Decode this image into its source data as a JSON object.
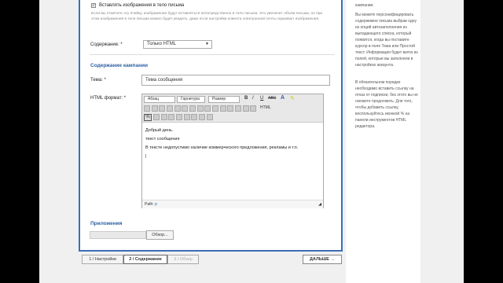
{
  "checkbox_label": "Вставлять изображения в тело письма",
  "checkbox_note": "Если вы отметите эту ячейку, изображения будут вставляться непосредственно в тело письма. Это увеличит объем письма, но при этом изображения в теле письма можно будет увидеть, даже если настройки клиента электронной почты скрывают изображения.",
  "content": {
    "label": "Содержание: *",
    "value": "Только HTML"
  },
  "campaign_heading": "Содержание кампании",
  "subject": {
    "label": "Тема: *",
    "value": "Тема сообщения"
  },
  "html_format": {
    "label": "HTML формат: *",
    "toolbar": {
      "paragraph": "Абзац",
      "font": "Гарнитура",
      "size": "Размер",
      "bold": "B",
      "italic": "I",
      "underline": "U",
      "strike": "ABC",
      "source": "HTML"
    },
    "body_lines": [
      "Добрый день.",
      "текст сообщения",
      "В тексте недопустимо наличие коммерческого предложения, рекламы и т.п."
    ],
    "path_label": "Path:",
    "path_value": "p"
  },
  "attachments": {
    "heading": "Приложения",
    "browse_label": "Обзор..."
  },
  "steps": {
    "step1": "1 / Настройки",
    "step2": "2 / Содержание",
    "step3": "3 / Обзор"
  },
  "next_button": "ДАЛЬШЕ →",
  "sidebar": {
    "top": "кампании.",
    "p1": "Вы можете персонифицировать содержимое письма выбрав одну из опций автозаполнения из выпадающего списка, который появится, когда вы поставите курсор в поле Тема или Простой текст. Информация будет взята из полей, которые вы заполняли в настройках аккаунта.",
    "p2": "В обязательном порядке необходимо вставить ссылку на отказ от подписки, без этого вы не сможете продолжить. Для того, чтобы добавить ссылку, воспользуйтесь иконкой % на панели инструментов HTML редактора."
  }
}
